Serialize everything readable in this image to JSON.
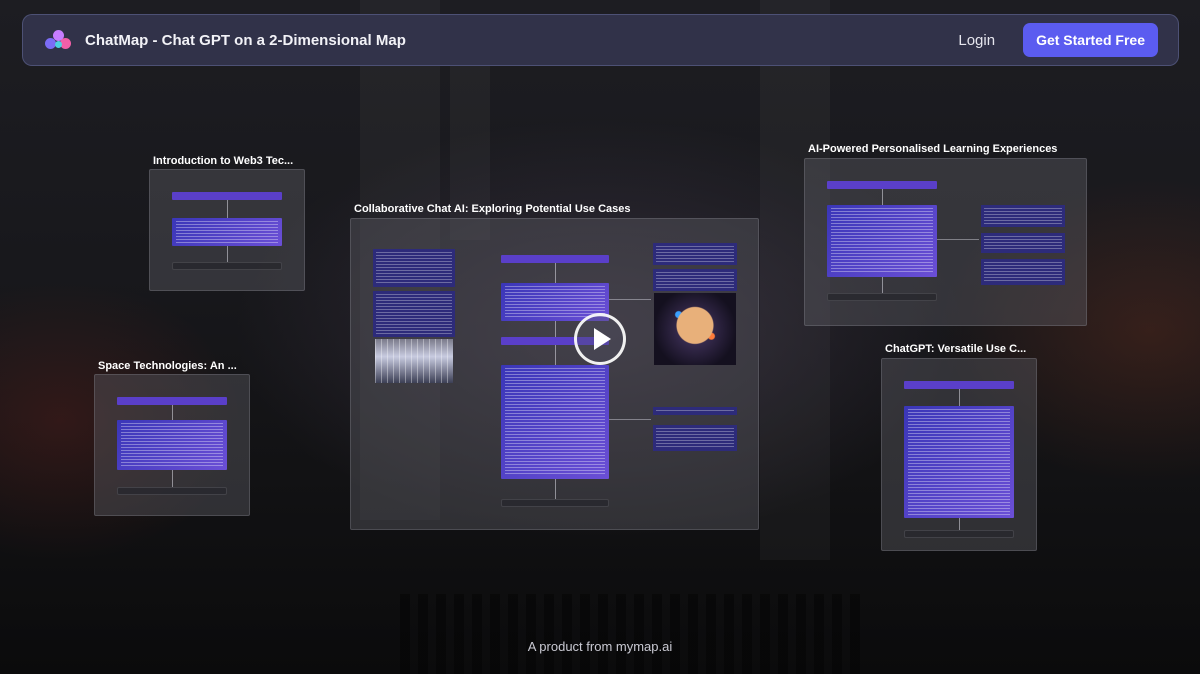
{
  "navbar": {
    "brand": "ChatMap - Chat GPT on a 2-Dimensional Map",
    "logo_icon": "chatmap-logo-icon",
    "login_label": "Login",
    "cta_label": "Get Started Free",
    "accent_color": "#5b5cf0"
  },
  "maps": {
    "web3": {
      "title": "Introduction to Web3 Tec..."
    },
    "space": {
      "title": "Space Technologies: An ..."
    },
    "collab": {
      "title": "Collaborative Chat AI: Exploring Potential Use Cases"
    },
    "learning": {
      "title": "AI-Powered Personalised Learning Experiences"
    },
    "chatgpt": {
      "title": "ChatGPT: Versatile Use C..."
    }
  },
  "video": {
    "play_icon": "play-icon"
  },
  "footer": {
    "prefix": "A product from ",
    "link": "mymap.ai"
  }
}
